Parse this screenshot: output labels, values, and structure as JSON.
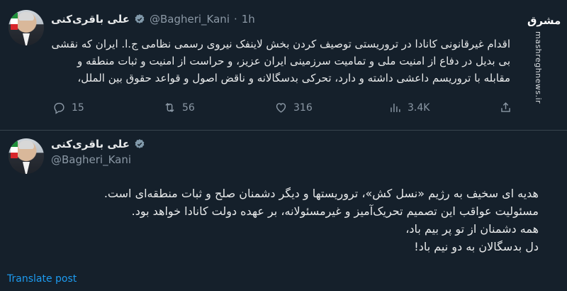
{
  "tweet1": {
    "name": "علی باقری‌کنی",
    "handle": "@Bagheri_Kani",
    "separator": "·",
    "time": "1h",
    "text": "اقدام غیرقانونی کانادا در تروریستی توصیف کردن بخش لاینفک نیروی رسمی نظامی ج.ا. ایران که نقشی بی بدیل در دفاع از امنیت ملی و تمامیت سرزمینی ایران عزیز، و حراست از امنیت و ثبات منطقه و مقابله با تروریسم داعشی داشته و دارد، تحرکی بدسگالانه و ناقض اصول و قواعد حقوق بین الملل،",
    "replies": "15",
    "retweets": "56",
    "likes": "316",
    "views": "3.4K"
  },
  "watermark": {
    "mark": "مشرق",
    "site": "mashreghnews.ir"
  },
  "tweet2": {
    "name": "علی باقری‌کنی",
    "handle": "@Bagheri_Kani",
    "lines": [
      "هدیه ای سخیف به رژیم «نسل کش»، تروریستها و دیگر دشمنان صلح و ثبات منطقه‌ای است.",
      "مسئولیت عواقب این تصمیم تحریک‌آمیز و غیرمسئولانه، بر عهده دولت کانادا خواهد بود.",
      "همه دشمنان از تو پر بیم باد،",
      "دل بدسگالان به دو نیم باد!"
    ],
    "translate": "Translate post"
  },
  "icons": {
    "reply": "reply-icon",
    "retweet": "retweet-icon",
    "like": "like-icon",
    "views": "views-icon",
    "share": "share-icon",
    "verified": "verified-badge-icon"
  },
  "colors": {
    "background": "#15202b",
    "text": "#e7e9ea",
    "muted": "#8b98a5",
    "link": "#1d9bf0",
    "verified": "#829aab"
  }
}
